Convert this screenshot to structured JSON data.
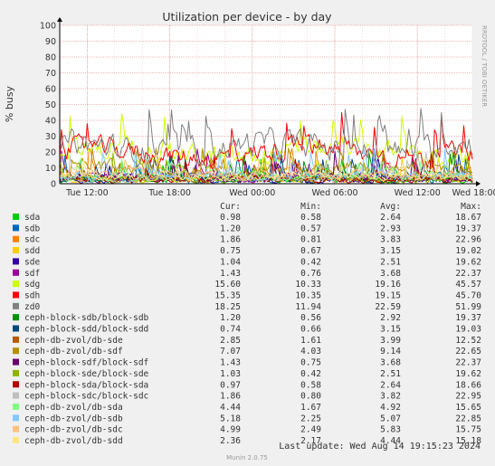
{
  "chart_data": {
    "type": "line",
    "title": "Utilization per device - by day",
    "ylabel": "% busy",
    "ylim": [
      0,
      100
    ],
    "yticks": [
      0,
      10,
      20,
      30,
      40,
      50,
      60,
      70,
      80,
      90,
      100
    ],
    "xticks": [
      "Tue 12:00",
      "Tue 18:00",
      "Wed 00:00",
      "Wed 06:00",
      "Wed 12:00",
      "Wed 18:00"
    ],
    "x_range_hours": [
      -30,
      0
    ],
    "xtick_hours": [
      -28,
      -22,
      -16,
      -10,
      -4,
      2
    ],
    "side_label": "RRDTOOL / TOBI OETIKER",
    "grid": true,
    "legend_headers": {
      "cur": "Cur:",
      "min": "Min:",
      "avg": "Avg:",
      "max": "Max:"
    },
    "series": [
      {
        "name": "sda",
        "color": "#00cc00",
        "cur": "0.98",
        "min": "0.58",
        "avg": "2.64",
        "max": "18.67"
      },
      {
        "name": "sdb",
        "color": "#0066b3",
        "cur": "1.20",
        "min": "0.57",
        "avg": "2.93",
        "max": "19.37"
      },
      {
        "name": "sdc",
        "color": "#ff8000",
        "cur": "1.86",
        "min": "0.81",
        "avg": "3.83",
        "max": "22.96"
      },
      {
        "name": "sdd",
        "color": "#ffcc00",
        "cur": "0.75",
        "min": "0.67",
        "avg": "3.15",
        "max": "19.02"
      },
      {
        "name": "sde",
        "color": "#330099",
        "cur": "1.04",
        "min": "0.42",
        "avg": "2.51",
        "max": "19.62"
      },
      {
        "name": "sdf",
        "color": "#990099",
        "cur": "1.43",
        "min": "0.76",
        "avg": "3.68",
        "max": "22.37"
      },
      {
        "name": "sdg",
        "color": "#ccff00",
        "cur": "15.60",
        "min": "10.33",
        "avg": "19.16",
        "max": "45.57"
      },
      {
        "name": "sdh",
        "color": "#ff0000",
        "cur": "15.35",
        "min": "10.35",
        "avg": "19.15",
        "max": "45.70"
      },
      {
        "name": "zd0",
        "color": "#808080",
        "cur": "18.25",
        "min": "11.94",
        "avg": "22.59",
        "max": "51.99"
      },
      {
        "name": "ceph-block-sdb/block-sdb",
        "color": "#008f00",
        "cur": "1.20",
        "min": "0.56",
        "avg": "2.92",
        "max": "19.37"
      },
      {
        "name": "ceph-block-sdd/block-sdd",
        "color": "#00487d",
        "cur": "0.74",
        "min": "0.66",
        "avg": "3.15",
        "max": "19.03"
      },
      {
        "name": "ceph-db-zvol/db-sde",
        "color": "#b35a00",
        "cur": "2.85",
        "min": "1.61",
        "avg": "3.99",
        "max": "12.52"
      },
      {
        "name": "ceph-db-zvol/db-sdf",
        "color": "#b38f00",
        "cur": "7.07",
        "min": "4.03",
        "avg": "9.14",
        "max": "22.65"
      },
      {
        "name": "ceph-block-sdf/block-sdf",
        "color": "#6b006b",
        "cur": "1.43",
        "min": "0.75",
        "avg": "3.68",
        "max": "22.37"
      },
      {
        "name": "ceph-block-sde/block-sde",
        "color": "#8fb300",
        "cur": "1.03",
        "min": "0.42",
        "avg": "2.51",
        "max": "19.62"
      },
      {
        "name": "ceph-block-sda/block-sda",
        "color": "#b30000",
        "cur": "0.97",
        "min": "0.58",
        "avg": "2.64",
        "max": "18.66"
      },
      {
        "name": "ceph-block-sdc/block-sdc",
        "color": "#bebebe",
        "cur": "1.86",
        "min": "0.80",
        "avg": "3.82",
        "max": "22.95"
      },
      {
        "name": "ceph-db-zvol/db-sda",
        "color": "#80ff80",
        "cur": "4.44",
        "min": "1.67",
        "avg": "4.92",
        "max": "15.65"
      },
      {
        "name": "ceph-db-zvol/db-sdb",
        "color": "#80c9ff",
        "cur": "5.18",
        "min": "2.25",
        "avg": "5.07",
        "max": "22.85"
      },
      {
        "name": "ceph-db-zvol/db-sdc",
        "color": "#ffc080",
        "cur": "4.99",
        "min": "2.49",
        "avg": "5.83",
        "max": "15.75"
      },
      {
        "name": "ceph-db-zvol/db-sdd",
        "color": "#ffe680",
        "cur": "2.36",
        "min": "2.17",
        "avg": "4.44",
        "max": "15.18"
      }
    ],
    "last_update": "Last update: Wed Aug 14 19:15:23 2024",
    "footer": "Munin 2.0.75"
  }
}
